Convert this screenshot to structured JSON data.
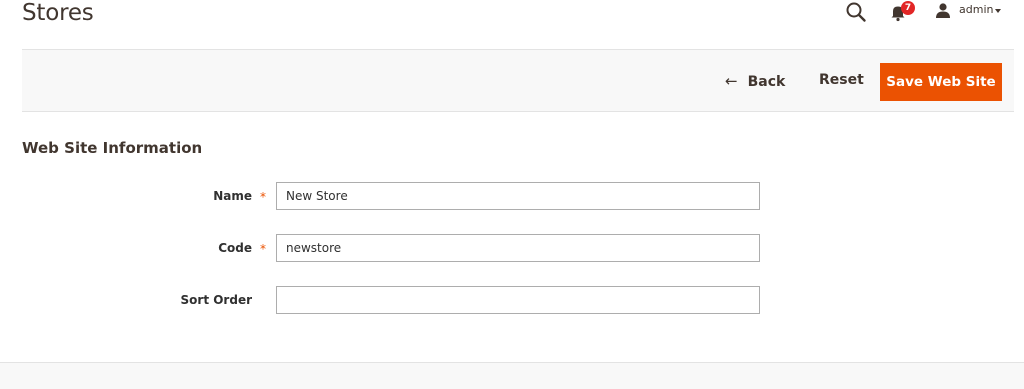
{
  "page": {
    "title": "Stores"
  },
  "header": {
    "notifications_count": "7",
    "user_name": "admin"
  },
  "toolbar": {
    "back_label": "Back",
    "reset_label": "Reset",
    "save_label": "Save Web Site"
  },
  "section": {
    "title": "Web Site Information"
  },
  "form": {
    "name": {
      "label": "Name",
      "value": "New Store",
      "required": true
    },
    "code": {
      "label": "Code",
      "value": "newstore",
      "required": true
    },
    "sort_order": {
      "label": "Sort Order",
      "value": "",
      "required": false
    }
  },
  "colors": {
    "accent": "#eb5202",
    "badge": "#e22626",
    "toolbar_bg": "#f8f8f8"
  },
  "icons": [
    "search-icon",
    "bell-icon",
    "user-icon",
    "caret-down-icon",
    "arrow-left-icon"
  ]
}
